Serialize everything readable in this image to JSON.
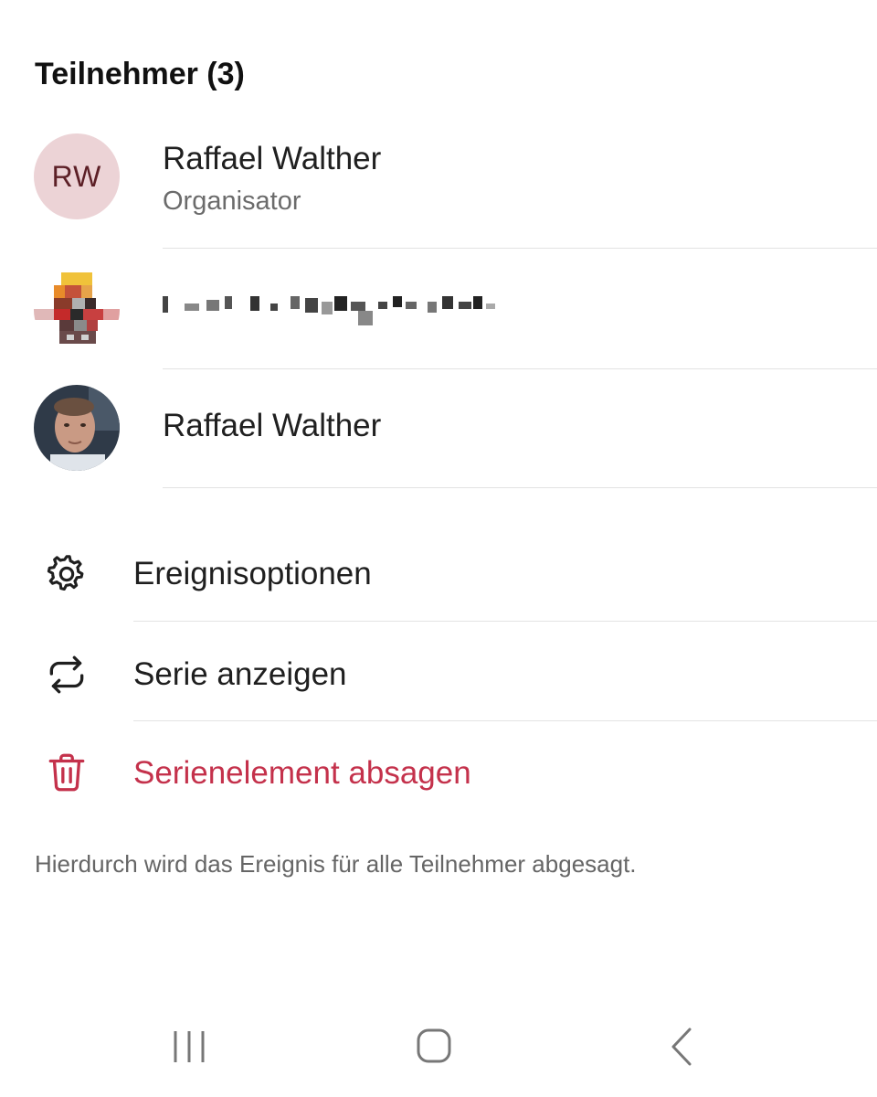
{
  "participants_section": {
    "title": "Teilnehmer (3)",
    "participants": [
      {
        "avatar_type": "initials",
        "initials": "RW",
        "avatar_bg_color": "#ecd3d6",
        "avatar_text_color": "#5c1f26",
        "name": "Raffael Walther",
        "role": "Organisator"
      },
      {
        "avatar_type": "photo-pixelated",
        "name_redacted": true
      },
      {
        "avatar_type": "photo",
        "name": "Raffael Walther"
      }
    ]
  },
  "actions": [
    {
      "icon": "gear-icon",
      "label": "Ereignisoptionen",
      "color": "#1f1f1f"
    },
    {
      "icon": "repeat-icon",
      "label": "Serie anzeigen",
      "color": "#1f1f1f"
    },
    {
      "icon": "trash-icon",
      "label": "Serienelement absagen",
      "color": "#c4314b"
    }
  ],
  "cancel_note": "Hierdurch wird das Ereignis für alle Teilnehmer abgesagt.",
  "system_nav": {
    "buttons": [
      "recent-apps-icon",
      "home-icon",
      "back-icon"
    ]
  },
  "colors": {
    "danger": "#c4314b",
    "divider": "#e3e3e3",
    "secondary_text": "#6b6b6b"
  }
}
